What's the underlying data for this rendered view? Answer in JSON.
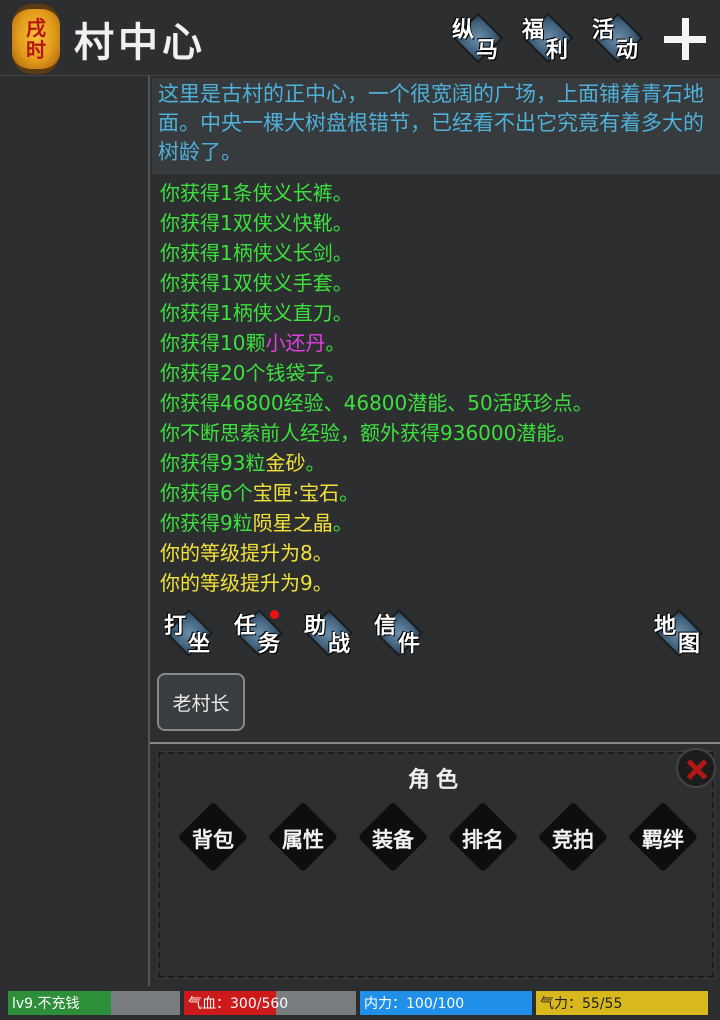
{
  "header": {
    "time_badge": [
      "戌",
      "时"
    ],
    "title": "村中心",
    "buttons": [
      {
        "g1": "纵",
        "g2": "马"
      },
      {
        "g1": "福",
        "g2": "利"
      },
      {
        "g1": "活",
        "g2": "动"
      }
    ]
  },
  "description": "这里是古村的正中心，一个很宽阔的广场，上面铺着青石地面。中央一棵大树盘根错节，已经看不出它究竟有着多大的树龄了。",
  "log": [
    {
      "color": "green",
      "parts": [
        {
          "t": "你获得1条侠义长裤。"
        }
      ]
    },
    {
      "color": "green",
      "parts": [
        {
          "t": "你获得1双侠义快靴。"
        }
      ]
    },
    {
      "color": "green",
      "parts": [
        {
          "t": "你获得1柄侠义长剑。"
        }
      ]
    },
    {
      "color": "green",
      "parts": [
        {
          "t": "你获得1双侠义手套。"
        }
      ]
    },
    {
      "color": "green",
      "parts": [
        {
          "t": "你获得1柄侠义直刀。"
        }
      ]
    },
    {
      "color": "green",
      "parts": [
        {
          "t": "你获得10颗"
        },
        {
          "t": "小还丹",
          "c": "magenta"
        },
        {
          "t": "。"
        }
      ]
    },
    {
      "color": "green",
      "parts": [
        {
          "t": "你获得20个钱袋子。"
        }
      ]
    },
    {
      "color": "green",
      "parts": [
        {
          "t": "你获得46800经验、46800潜能、50活跃珍点。"
        }
      ]
    },
    {
      "color": "green",
      "parts": [
        {
          "t": "你不断思索前人经验，额外获得936000潜能。"
        }
      ]
    },
    {
      "color": "green",
      "parts": [
        {
          "t": "你获得93粒"
        },
        {
          "t": "金砂",
          "c": "yellow"
        },
        {
          "t": "。"
        }
      ]
    },
    {
      "color": "green",
      "parts": [
        {
          "t": "你获得6个"
        },
        {
          "t": "宝匣·宝石",
          "c": "yellow"
        },
        {
          "t": "。"
        }
      ]
    },
    {
      "color": "green",
      "parts": [
        {
          "t": "你获得9粒"
        },
        {
          "t": "陨星之晶",
          "c": "yellow"
        },
        {
          "t": "。"
        }
      ]
    },
    {
      "color": "yellow",
      "parts": [
        {
          "t": "你的等级提升为8。"
        }
      ]
    },
    {
      "color": "yellow",
      "parts": [
        {
          "t": "你的等级提升为9。"
        }
      ]
    }
  ],
  "actions": [
    {
      "g1": "打",
      "g2": "坐"
    },
    {
      "g1": "任",
      "g2": "务"
    },
    {
      "g1": "助",
      "g2": "战"
    },
    {
      "g1": "信",
      "g2": "件"
    },
    {
      "g1": "地",
      "g2": "图"
    }
  ],
  "npc": "老村长",
  "panel": {
    "title": "角色",
    "buttons": [
      "背包",
      "属性",
      "装备",
      "排名",
      "竞拍",
      "羁绊"
    ]
  },
  "status": {
    "level": {
      "text": "lv9.不充钱",
      "fraction": 0.6,
      "color": "#2e8f3a"
    },
    "hp": {
      "text": "气血：300/560",
      "fraction": 0.536,
      "color": "#cc1a1a"
    },
    "neili": {
      "text": "内力：100/100",
      "fraction": 1.0,
      "color": "#1f8fe8"
    },
    "qili": {
      "text": "气力：55/55",
      "fraction": 1.0,
      "color": "#d9b81e"
    }
  }
}
